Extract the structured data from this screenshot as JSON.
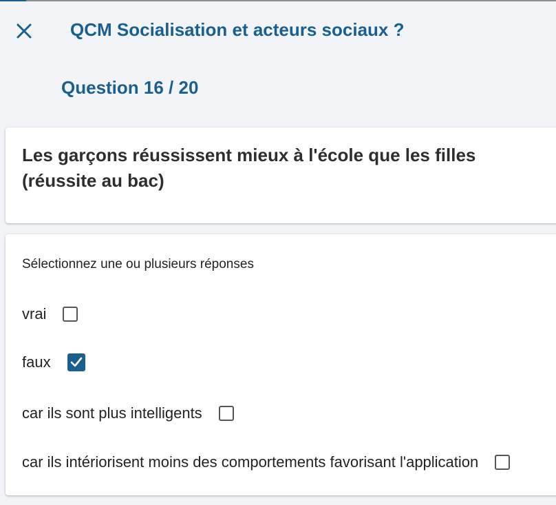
{
  "colors": {
    "accent": "#1a5f8f",
    "checkbox_checked": "#1a5f8f"
  },
  "header": {
    "close_icon": "close-icon",
    "title": "QCM Socialisation et acteurs sociaux ?",
    "progress": "Question 16 / 20"
  },
  "question": {
    "text": "Les garçons réussissent mieux à l'école que les filles (réussite au bac)"
  },
  "answers": {
    "instruction": "Sélectionnez une ou plusieurs réponses",
    "options": [
      {
        "label": "vrai",
        "checked": false
      },
      {
        "label": "faux",
        "checked": true
      },
      {
        "label": "car ils sont plus intelligents",
        "checked": false
      },
      {
        "label": "car ils intériorisent moins des comportements favorisant l'application",
        "checked": false
      }
    ]
  }
}
